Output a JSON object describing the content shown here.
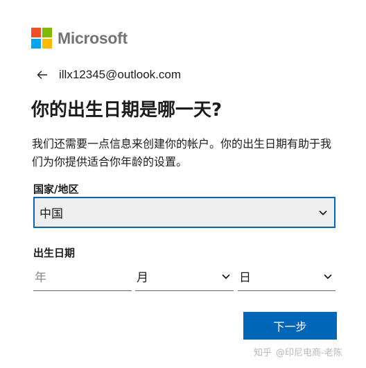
{
  "brand": {
    "name": "Microsoft",
    "logo_colors": [
      "#f25022",
      "#7fba00",
      "#00a4ef",
      "#ffb900"
    ]
  },
  "identity": {
    "back_icon": "arrow-left-icon",
    "email": "illx12345@outlook.com"
  },
  "page": {
    "title": "你的出生日期是哪一天?",
    "description": "我们还需要一点信息来创建你的帐户。你的出生日期有助于我们为你提供适合你年龄的设置。"
  },
  "country": {
    "label": "国家/地区",
    "selected": "中国",
    "icon": "chevron-down-icon"
  },
  "birthdate": {
    "label": "出生日期",
    "year_placeholder": "年",
    "month_value": "月",
    "day_value": "日"
  },
  "actions": {
    "next_label": "下一步",
    "accent": "#0067b8"
  },
  "watermark": {
    "site": "知乎",
    "author": "@印尼电商-老陈"
  }
}
